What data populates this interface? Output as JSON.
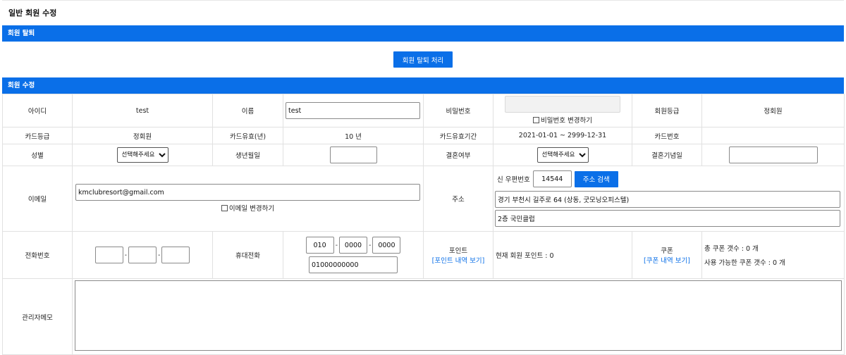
{
  "page": {
    "title": "일반 회원 수정"
  },
  "withdraw": {
    "section_title": "회원 탈퇴",
    "button_label": "회원 탈퇴 처리"
  },
  "edit": {
    "section_title": "회원 수정",
    "id_label": "아이디",
    "id_value": "test",
    "name_label": "이름",
    "name_value": "test",
    "password_label": "비밀번호",
    "password_change_label": "비밀번호 변경하기",
    "grade_label": "회원등급",
    "grade_value": "정회원",
    "card_grade_label": "카드등급",
    "card_grade_value": "정회원",
    "card_years_label": "카드유효(년)",
    "card_years_value": "10 년",
    "card_period_label": "카드유효기간",
    "card_period_value": "2021-01-01 ~ 2999-12-31",
    "card_number_label": "카드번호",
    "card_number_value": "",
    "gender_label": "성별",
    "gender_selected": "선택해주세요",
    "birthday_label": "생년월일",
    "married_label": "결혼여부",
    "married_selected": "선택해주세요",
    "anniversary_label": "결혼기념일",
    "email_label": "이메일",
    "email_value": "kmclubresort@gmail.com",
    "email_change_label": "이메일 변경하기",
    "address_label": "주소",
    "zip_label": "신 우편번호",
    "zip_value": "14544",
    "address_search_label": "주소 검색",
    "address1_value": "경기 부천시 길주로 64 (상동, 굿모닝오피스텔)",
    "address2_value": "2층 국민클럽",
    "phone_label": "전화번호",
    "phone1_value": "",
    "phone2_value": "",
    "phone3_value": "",
    "mobile_label": "휴대전화",
    "mobile1_value": "010",
    "mobile2_value": "0000",
    "mobile3_value": "0000",
    "mobile_full_value": "01000000000",
    "point_label": "포인트",
    "point_history_link": "[포인트 내역 보기]",
    "point_current": "현재 회원 포인트 : 0",
    "coupon_label": "쿠폰",
    "coupon_history_link": "[쿠폰 내역 보기]",
    "coupon_total": "총 쿠폰 갯수 : 0 개",
    "coupon_available": "사용 가능한 쿠폰 갯수 : 0 개",
    "memo_label": "관리자메모",
    "memo_value": ""
  },
  "colors": {
    "accent": "#0a6fe8",
    "border": "#e1e1e1"
  }
}
